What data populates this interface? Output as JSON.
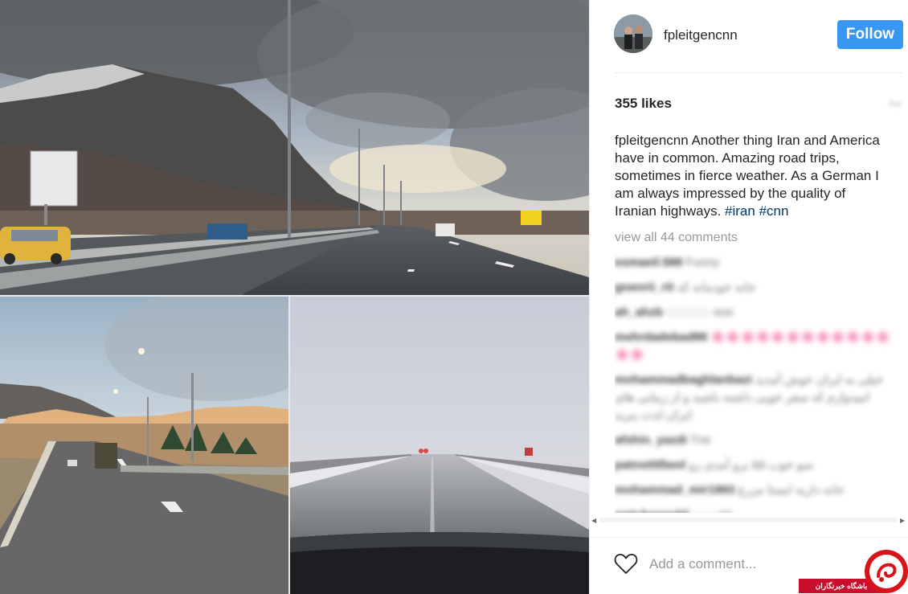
{
  "post": {
    "username": "fpleitgencnn",
    "follow_label": "Follow",
    "likes": "355 likes",
    "age": "4w",
    "caption": {
      "username": "fpleitgencnn",
      "text": " Another thing Iran and America have in common. Amazing road trips, sometimes in fierce weather. As a German I am always impressed by the quality of Iranian highways. ",
      "tag1": "#iran",
      "tag2": "#cnn"
    },
    "view_all_comments": "view all 44 comments",
    "comments": [
      {
        "user": "esmaeil.588",
        "text": " Funny"
      },
      {
        "user": "gnenrii_rit",
        "text": " خانه خودمانه که"
      },
      {
        "user": "ah_ahzb",
        "text": " ::::::::::::: ooo"
      },
      {
        "user": "mehrdadebad88",
        "text": " 🌸🌸🌸🌸🌸🌸🌸🌸🌸🌸🌸🌸🌸🌸"
      },
      {
        "user": "mohammadbaghlanbazi",
        "text": " خیلی به ایران خوش آمدید امیدوارم که سفر خوبی داشته باشید و از زیبایی های ایران لذت ببرید"
      },
      {
        "user": "afshin_yazdi",
        "text": " Tne"
      },
      {
        "user": "patnstttllwol",
        "text": " سو خوب ۵۵ برو آمدی رو"
      },
      {
        "user": "mohammad_mir1993",
        "text": " خانه داریه ایستا مزرع"
      },
      {
        "user": "watchoworld",
        "text": " ::::::: ##"
      }
    ],
    "add_comment_placeholder": "Add a comment..."
  },
  "watermark": {
    "text": "باشگاه خبرنگاران"
  },
  "colors": {
    "follow_button": "#3897f0",
    "hashtag": "#003569",
    "watermark": "#c8102e"
  },
  "icons": {
    "like": "heart-outline-icon",
    "watermark_logo": "red-circle-logo"
  }
}
